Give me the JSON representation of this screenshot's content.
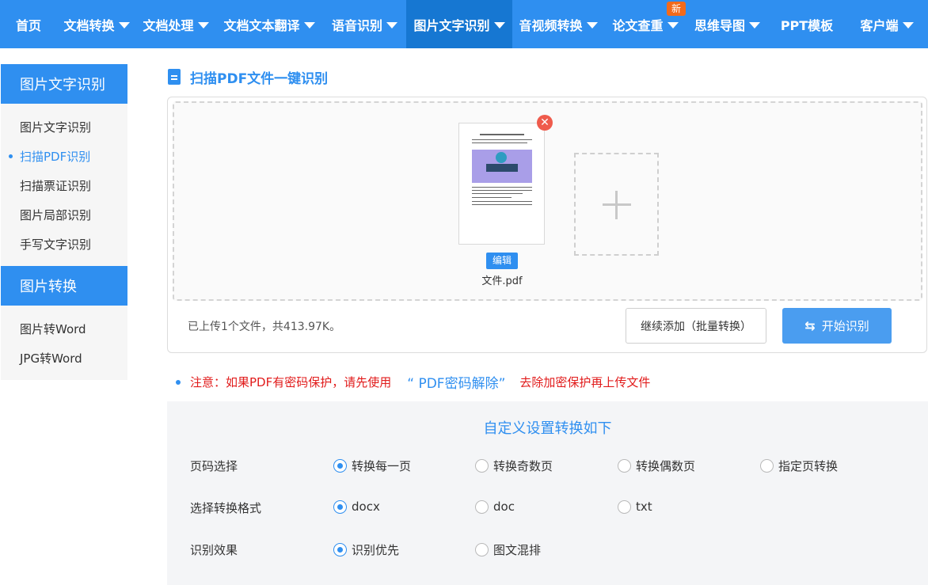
{
  "nav": {
    "items": [
      {
        "label": "首页",
        "dropdown": false
      },
      {
        "label": "文档转换",
        "dropdown": true
      },
      {
        "label": "文档处理",
        "dropdown": true
      },
      {
        "label": "文档文本翻译",
        "dropdown": true
      },
      {
        "label": "语音识别",
        "dropdown": true
      },
      {
        "label": "图片文字识别",
        "dropdown": true,
        "active": true
      },
      {
        "label": "音视频转换",
        "dropdown": true
      },
      {
        "label": "论文查重",
        "dropdown": true
      },
      {
        "label": "思维导图",
        "dropdown": true
      },
      {
        "label": "PPT模板",
        "dropdown": false
      },
      {
        "label": "客户端",
        "dropdown": true
      }
    ],
    "new_badge": "新"
  },
  "sidebar": {
    "section1_title": "图片文字识别",
    "section1_items": [
      "图片文字识别",
      "扫描PDF识别",
      "扫描票证识别",
      "图片局部识别",
      "手写文字识别"
    ],
    "active_item": "扫描PDF识别",
    "section2_title": "图片转换",
    "section2_items": [
      "图片转Word",
      "JPG转Word"
    ]
  },
  "main": {
    "title": "扫描PDF文件一键识别",
    "file": {
      "name": "文件.pdf",
      "edit_label": "编辑"
    },
    "upload_info": "已上传1个文件，共413.97K。",
    "continue_label": "继续添加（批量转换）",
    "start_label": "开始识别"
  },
  "notice": {
    "prefix": "注意：如果PDF有密码保护，请先使用",
    "link": "“ PDF密码解除”",
    "suffix": "去除加密保护再上传文件"
  },
  "settings": {
    "title": "自定义设置转换如下",
    "rows": [
      {
        "label": "页码选择",
        "options": [
          "转换每一页",
          "转换奇数页",
          "转换偶数页",
          "指定页转换"
        ],
        "selected": "转换每一页"
      },
      {
        "label": "选择转换格式",
        "options": [
          "docx",
          "doc",
          "txt"
        ],
        "selected": "docx"
      },
      {
        "label": "识别效果",
        "options": [
          "识别优先",
          "图文混排"
        ],
        "selected": "识别优先"
      }
    ]
  },
  "colors": {
    "brand": "#2f8ff0",
    "nav_active": "#1677d2",
    "danger": "#e11b1b",
    "badge": "#f26a1b"
  }
}
